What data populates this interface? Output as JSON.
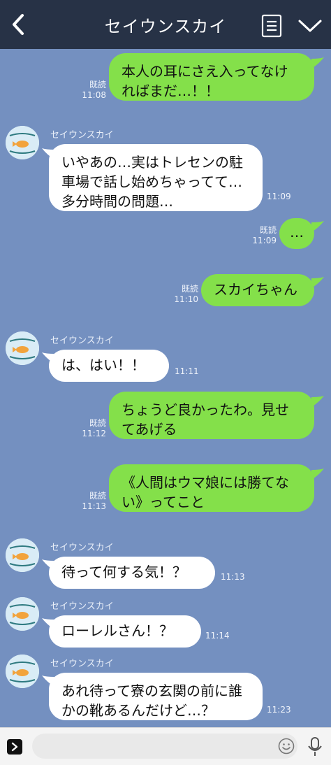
{
  "header": {
    "title": "セイウンスカイ"
  },
  "messages": [
    {
      "dir": "out",
      "text": "本人の耳にさえ入ってなければまだ…！！",
      "read": "既読",
      "time": "11:08"
    },
    {
      "dir": "in",
      "sender": "セイウンスカイ",
      "text": "いやあの…実はトレセンの駐車場で話し始めちゃってて…多分時間の問題…",
      "time": "11:09"
    },
    {
      "dir": "out",
      "text": "…",
      "read": "既読",
      "time": "11:09"
    },
    {
      "dir": "out",
      "text": "スカイちゃん",
      "read": "既読",
      "time": "11:10"
    },
    {
      "dir": "in",
      "sender": "セイウンスカイ",
      "text": "は、はい！！",
      "time": "11:11"
    },
    {
      "dir": "out",
      "text": "ちょうど良かったわ。見せてあげる",
      "read": "既読",
      "time": "11:12"
    },
    {
      "dir": "out",
      "text": "《人間はウマ娘には勝てない》ってこと",
      "read": "既読",
      "time": "11:13"
    },
    {
      "dir": "in",
      "sender": "セイウンスカイ",
      "text": "待って何する気！？",
      "time": "11:13"
    },
    {
      "dir": "in",
      "sender": "セイウンスカイ",
      "text": "ローレルさん！？",
      "time": "11:14"
    },
    {
      "dir": "in",
      "sender": "セイウンスカイ",
      "text": "あれ待って寮の玄関の前に誰かの靴あるんだけど…？",
      "time": "11:23"
    }
  ],
  "icons": {
    "back": "chevron-left-icon",
    "menu": "menu-icon",
    "collapse": "chevron-down-icon",
    "expand": "expand-icon",
    "emoji": "emoji-icon",
    "mic": "mic-icon"
  },
  "colors": {
    "header_bg": "#273246",
    "chat_bg": "#7490c0",
    "outgoing_bubble": "#84e04a",
    "incoming_bubble": "#ffffff"
  }
}
